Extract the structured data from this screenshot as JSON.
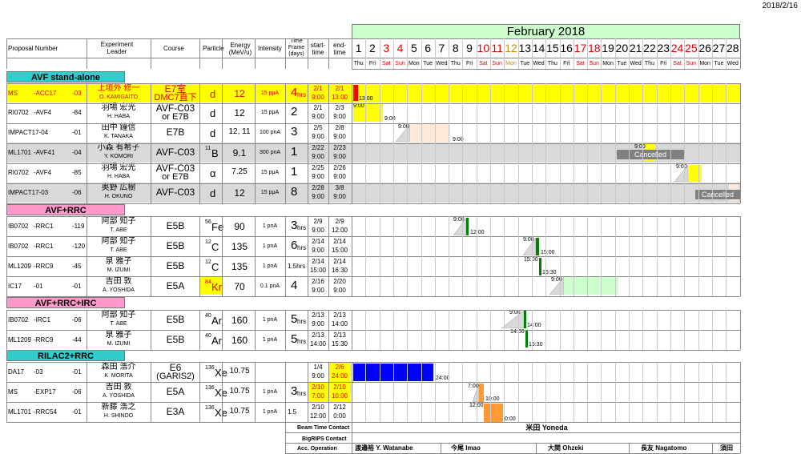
{
  "print_date": "2018/2/16",
  "month_title": "February 2018",
  "headers": {
    "proposal": "Proposal Number",
    "leader": "Experiment Leader",
    "course": "Course",
    "particle": "Particle",
    "energy": "Energy (MeV/u)",
    "intensity": "Intensity",
    "timeframe": "Time Frame (days)",
    "start": "start- time",
    "end": "end- time"
  },
  "days": [
    "1",
    "2",
    "3",
    "4",
    "5",
    "6",
    "7",
    "8",
    "9",
    "10",
    "11",
    "12",
    "13",
    "14",
    "15",
    "16",
    "17",
    "18",
    "19",
    "20",
    "21",
    "22",
    "23",
    "24",
    "25",
    "26",
    "27",
    "28"
  ],
  "dows": [
    "Thu",
    "Fri",
    "Sat",
    "Sun",
    "Mon",
    "Tue",
    "Wed",
    "Thu",
    "Fri",
    "Sat",
    "Sun",
    "Mon",
    "Tue",
    "Wed",
    "Thu",
    "Fri",
    "Sat",
    "Sun",
    "Mon",
    "Tue",
    "Wed",
    "Thu",
    "Fri",
    "Sat",
    "Sun",
    "Mon",
    "Tue",
    "Wed"
  ],
  "sections": {
    "s1": "AVF stand-alone",
    "s2": "AVF+RRC",
    "s3": "AVF+RRC+IRC",
    "s4": "RILAC2+RRC"
  },
  "rows": [
    {
      "p1": "MS",
      "p2": "-ACC17",
      "p3": "-03",
      "l1": "上垣外 修一",
      "l2": "O. KAMIGAITO",
      "c1": "E7室",
      "c2": "DMC7直下",
      "part": "d",
      "pre": "",
      "energy": "12",
      "intensity": "15 pμA",
      "tf": "4",
      "tfu": "hrs",
      "s1": "2/1",
      "s2": "9:00",
      "e1": "2/1",
      "e2": "13:00"
    },
    {
      "p1": "RI0702",
      "p2": "-AVF4",
      "p3": "-84",
      "l1": "羽場 宏光",
      "l2": "H. HABA",
      "c1": "AVF-C03",
      "c2": "or E7B",
      "part": "d",
      "pre": "",
      "energy": "12",
      "intensity": "15 pμA",
      "tf": "2",
      "tfu": "",
      "s1": "2/1",
      "s2": "9:00",
      "e1": "2/3",
      "e2": "9:00"
    },
    {
      "p1": "IMPACT17-04",
      "p2": "",
      "p3": "-01",
      "l1": "田中 鐘信",
      "l2": "K. TANAKA",
      "c1": "E7B",
      "c2": "",
      "part": "d",
      "pre": "",
      "energy": "12, 11",
      "intensity": "100 pnA",
      "tf": "3",
      "tfu": "",
      "s1": "2/5",
      "s2": "9:00",
      "e1": "2/8",
      "e2": "9:00"
    },
    {
      "p1": "ML1701",
      "p2": "-AVF41",
      "p3": "-04",
      "l1": "小森 有希子",
      "l2": "Y. KOMORI",
      "c1": "AVF-C03",
      "c2": "",
      "part": "B",
      "pre": "11",
      "energy": "9.1",
      "intensity": "300 pnA",
      "tf": "1",
      "tfu": "",
      "s1": "2/22",
      "s2": "9:00",
      "e1": "2/23",
      "e2": "9:00"
    },
    {
      "p1": "RI0702",
      "p2": "-AVF4",
      "p3": "-85",
      "l1": "羽場 宏光",
      "l2": "H. HABA",
      "c1": "AVF-C03",
      "c2": "or E7B",
      "part": "α",
      "pre": "",
      "energy": "7.25",
      "intensity": "15 pμA",
      "tf": "1",
      "tfu": "",
      "s1": "2/25",
      "s2": "9:00",
      "e1": "2/26",
      "e2": "9:00"
    },
    {
      "p1": "IMPACT17-03",
      "p2": "",
      "p3": "-06",
      "l1": "奥野 広樹",
      "l2": "H. OKUNO",
      "c1": "AVF-C03",
      "c2": "",
      "part": "d",
      "pre": "",
      "energy": "12",
      "intensity": "15 pμA",
      "tf": "8",
      "tfu": "",
      "s1": "2/28",
      "s2": "9:00",
      "e1": "3/8",
      "e2": "9:00"
    },
    {
      "p1": "IB0702",
      "p2": "-RRC1",
      "p3": "-119",
      "l1": "阿部 知子",
      "l2": "T. ABE",
      "c1": "E5B",
      "c2": "",
      "part": "Fe",
      "pre": "56",
      "energy": "90",
      "intensity": "1 pnA",
      "tf": "3",
      "tfu": "hrs",
      "s1": "2/9",
      "s2": "9:00",
      "e1": "2/9",
      "e2": "12:00"
    },
    {
      "p1": "IB0702",
      "p2": "-RRC1",
      "p3": "-120",
      "l1": "阿部 知子",
      "l2": "T. ABE",
      "c1": "E5B",
      "c2": "",
      "part": "C",
      "pre": "12",
      "energy": "135",
      "intensity": "1 pnA",
      "tf": "6",
      "tfu": "hrs",
      "s1": "2/14",
      "s2": "9:00",
      "e1": "2/14",
      "e2": "15:00"
    },
    {
      "p1": "ML1209",
      "p2": "-RRC9",
      "p3": "-45",
      "l1": "泉 雅子",
      "l2": "M. IZUMI",
      "c1": "E5B",
      "c2": "",
      "part": "C",
      "pre": "12",
      "energy": "135",
      "intensity": "1 pnA",
      "tf": "1.5hrs",
      "tfu": "",
      "s1": "2/14",
      "s2": "15:00",
      "e1": "2/14",
      "e2": "16:30"
    },
    {
      "p1": "IC17",
      "p2": "-01",
      "p3": "-01",
      "l1": "吉田 敦",
      "l2": "A. YOSHIDA",
      "c1": "E5A",
      "c2": "",
      "part": "Kr",
      "pre": "84",
      "energy": "70",
      "intensity": "0.1 pnA",
      "tf": "4",
      "tfu": "",
      "s1": "2/16",
      "s2": "9:00",
      "e1": "2/20",
      "e2": "9:00"
    },
    {
      "p1": "IB0702",
      "p2": "-IRC1",
      "p3": "-06",
      "l1": "阿部 知子",
      "l2": "T. ABE",
      "c1": "E5B",
      "c2": "",
      "part": "Ar",
      "pre": "40",
      "energy": "160",
      "intensity": "1 pnA",
      "tf": "5",
      "tfu": "hrs",
      "s1": "2/13",
      "s2": "9:00",
      "e1": "2/13",
      "e2": "14:00"
    },
    {
      "p1": "ML1209",
      "p2": "-RRC9",
      "p3": "-44",
      "l1": "泉 雅子",
      "l2": "M. IZUMI",
      "c1": "E5B",
      "c2": "",
      "part": "Ar",
      "pre": "40",
      "energy": "160",
      "intensity": "1 pnA",
      "tf": "5",
      "tfu": "hrs",
      "s1": "2/13",
      "s2": "14:00",
      "e1": "2/13",
      "e2": "15:30"
    },
    {
      "p1": "DA17",
      "p2": "-03",
      "p3": "-01",
      "l1": "森田 浩介",
      "l2": "K. MORITA",
      "c1": "E6",
      "c2": "(GARIS2)",
      "part": "Xe",
      "pre": "136",
      "energy": "10.75",
      "intensity": "",
      "tf": "",
      "tfu": "",
      "s1": "1/4",
      "s2": "9:00",
      "e1": "2/6",
      "e2": "24:00"
    },
    {
      "p1": "MS",
      "p2": "-EXP17",
      "p3": "-06",
      "l1": "吉田 敦",
      "l2": "A. YOSHIDA",
      "c1": "E5A",
      "c2": "",
      "part": "Xe",
      "pre": "136",
      "energy": "10.75",
      "intensity": "1 pnA",
      "tf": "3",
      "tfu": "hrs",
      "s1": "2/10",
      "s2": "7:00",
      "e1": "2/10",
      "e2": "10:00"
    },
    {
      "p1": "ML1701",
      "p2": "-RRC54",
      "p3": "-01",
      "l1": "新藤 浩之",
      "l2": "H. SHINDO",
      "c1": "E3A",
      "c2": "",
      "part": "Xe",
      "pre": "136",
      "energy": "10.75",
      "intensity": "1 pnA",
      "tf": "1.5",
      "tfu": "",
      "s1": "2/10",
      "s2": "12:00",
      "e1": "2/12",
      "e2": "0:00"
    }
  ],
  "gantt_labels": {
    "r0": "13:00",
    "r1a": "9:00",
    "r1b": "9:00",
    "r2a": "9:00",
    "r2b": "9:00",
    "r3": "9:00",
    "r3c": "Cancelled",
    "r4": "9:00",
    "r5c": "Cancelled",
    "r6a": "9:00",
    "r6b": "12:00",
    "r7a": "9:00",
    "r7b": "15:00",
    "r8a": "15:00",
    "r8b": "16:30",
    "r9": "9:00",
    "r10a": "9:00",
    "r10b": "14:00",
    "r11a": "14:00",
    "r11b": "15:30",
    "r12": "24:00",
    "r13a": "7:00",
    "r13b": "10:00",
    "r14a": "12:00",
    "r14b": "0:00"
  },
  "footer": {
    "beam_label": "Beam Time Contact",
    "beam_value": "米田 Yoneda",
    "bigrips_label": "BigRIPS Contact",
    "acc_label": "Acc. Operation",
    "op1": "渡邉裕 Y. Watanabe",
    "op2": "今尾 Imao",
    "op3": "大関 Ohzeki",
    "op4": "長友 Nagatomo",
    "op5": "須田"
  },
  "colors": {
    "title_bg": "#ccffcc",
    "section_cyan": "#33cccc",
    "section_pink": "#ff99cc",
    "yellow": "#ffff00",
    "gray_row": "#d9d9d9",
    "red_bar": "#ff0000",
    "green_bar": "#008000",
    "light_green": "#ccffcc",
    "blue_bar": "#0000ff",
    "orange_bar": "#ff9933",
    "peach": "#fde9d9"
  }
}
